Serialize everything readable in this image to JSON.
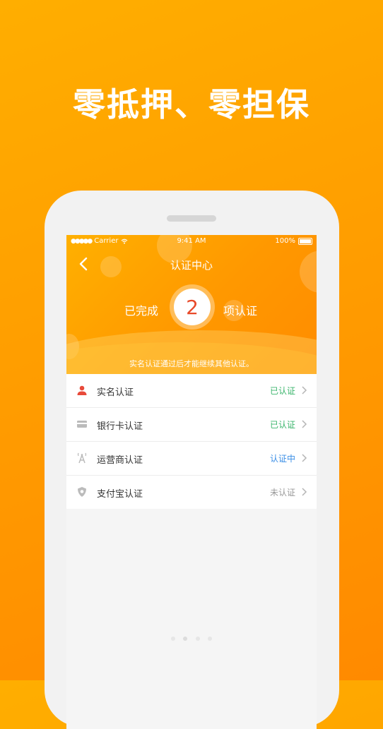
{
  "headline": "零抵押、零担保",
  "status_bar": {
    "carrier": "Carrier",
    "time": "9:41 AM",
    "battery": "100%"
  },
  "nav": {
    "title": "认证中心"
  },
  "progress": {
    "prefix": "已完成",
    "count": "2",
    "suffix": "项认证"
  },
  "hint": "实名认证通过后才能继续其他认证。",
  "items": [
    {
      "label": "实名认证",
      "status": "已认证",
      "status_color": "#3bb56c",
      "icon": "person-icon",
      "icon_color": "#e84a3a"
    },
    {
      "label": "银行卡认证",
      "status": "已认证",
      "status_color": "#3bb56c",
      "icon": "bank-card-icon",
      "icon_color": "#bbbbbb"
    },
    {
      "label": "运营商认证",
      "status": "认证中",
      "status_color": "#3a8ee6",
      "icon": "signal-tower-icon",
      "icon_color": "#bbbbbb"
    },
    {
      "label": "支付宝认证",
      "status": "未认证",
      "status_color": "#999999",
      "icon": "alipay-shield-icon",
      "icon_color": "#bbbbbb"
    }
  ],
  "colors": {
    "accent": "#ff9a00",
    "count_text": "#e84a2a"
  }
}
